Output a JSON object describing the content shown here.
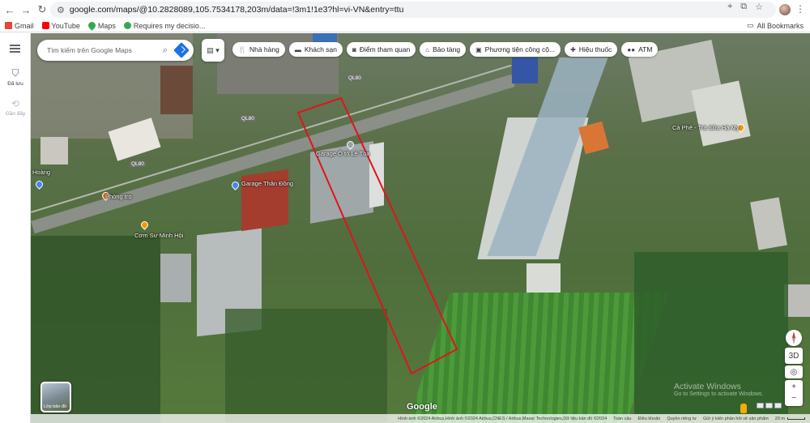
{
  "browser": {
    "url": "google.com/maps/@10.2828089,105.7534178,203m/data=!3m1!1e3?hl=vi-VN&entry=ttu",
    "bookmarks": [
      {
        "label": "Gmail",
        "icon": "gmail-icon",
        "color": "#ea4335"
      },
      {
        "label": "YouTube",
        "icon": "youtube-icon",
        "color": "#ff0000"
      },
      {
        "label": "Maps",
        "icon": "maps-icon",
        "color": "#34a853"
      },
      {
        "label": "Requires my decisio...",
        "icon": "check-circle-icon",
        "color": "#34a853"
      }
    ],
    "all_bookmarks": "All Bookmarks"
  },
  "rail": {
    "saved": "Đã lưu",
    "recent": "Gần đây"
  },
  "search": {
    "placeholder": "Tìm kiếm trên Google Maps"
  },
  "chips": [
    {
      "label": "Nhà hàng",
      "icon": "restaurant-icon"
    },
    {
      "label": "Khách sạn",
      "icon": "hotel-icon"
    },
    {
      "label": "Điểm tham quan",
      "icon": "camera-icon"
    },
    {
      "label": "Bảo tàng",
      "icon": "museum-icon"
    },
    {
      "label": "Phương tiện công cộ...",
      "icon": "transit-icon"
    },
    {
      "label": "Hiệu thuốc",
      "icon": "pharmacy-icon"
    },
    {
      "label": "ATM",
      "icon": "atm-icon"
    }
  ],
  "map": {
    "roads": [
      "QL80",
      "QL80",
      "QL80"
    ],
    "places": [
      {
        "name": "Garage Thân Đồng",
        "color": "#4285f4"
      },
      {
        "name": "Cà Phê - Trà Sữa Hà My",
        "color": "#f29900"
      },
      {
        "name": "Cơm Sư Minh Hội",
        "color": "#f29900"
      },
      {
        "name": "Phòng trọ",
        "color": "#e8711a"
      },
      {
        "name": "Garage Ô tô Lê Tòa",
        "color": "#9aa0a6"
      },
      {
        "name": "Hoàng",
        "color": "#4285f4"
      }
    ],
    "layer_label": "Lớp bản đồ",
    "watermark": "Google",
    "activate_line1": "Activate Windows",
    "activate_line2": "Go to Settings to activate Windows.",
    "controls": [
      "3D",
      "+",
      "−"
    ]
  },
  "footer": {
    "attribution": "Hình ảnh ©2024 Airbus,Hình ảnh ©2024 Airbus,CNES / Airbus,Maxar Technologies,Dữ liệu bản đồ ©2024",
    "links": [
      "Toàn cầu",
      "Điều khoản",
      "Quyền riêng tư",
      "Gửi ý kiến phản hồi về sản phẩm"
    ],
    "scale": "20 m"
  }
}
